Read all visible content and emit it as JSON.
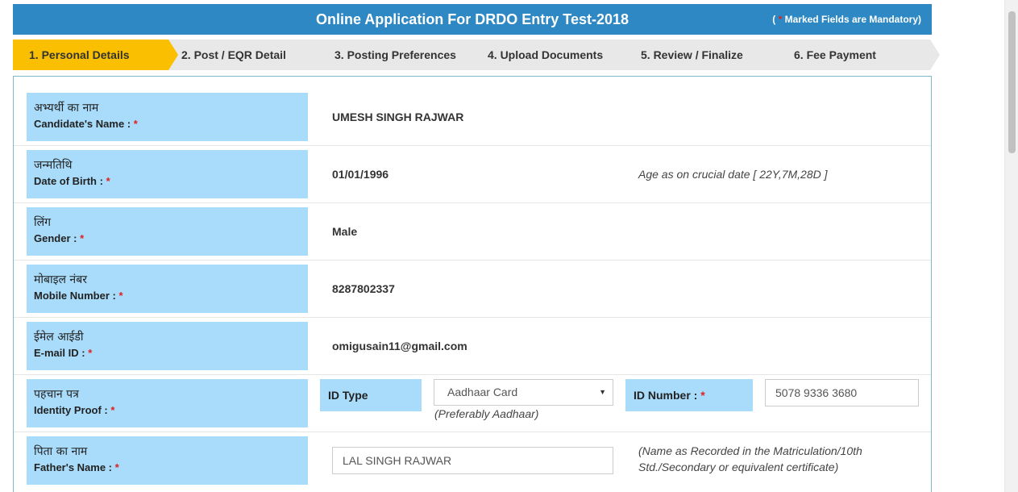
{
  "header": {
    "title": "Online Application For DRDO Entry Test-2018",
    "mandatory_open": "(",
    "mandatory_star": "*",
    "mandatory_text": " Marked Fields are Mandatory)"
  },
  "steps": [
    {
      "label": "1. Personal Details",
      "active": true
    },
    {
      "label": "2. Post / EQR Detail",
      "active": false
    },
    {
      "label": "3. Posting Preferences",
      "active": false
    },
    {
      "label": "4. Upload Documents",
      "active": false
    },
    {
      "label": "5. Review / Finalize",
      "active": false
    },
    {
      "label": "6. Fee Payment",
      "active": false
    }
  ],
  "form": {
    "required_mark": "*",
    "candidate_name": {
      "label_hi": "अभ्यर्थी का नाम",
      "label_en": "Candidate's Name :",
      "value": "UMESH SINGH RAJWAR"
    },
    "dob": {
      "label_hi": "जन्मतिथि",
      "label_en": "Date of Birth :",
      "value": "01/01/1996",
      "age_note": "Age as on crucial date [ 22Y,7M,28D ]"
    },
    "gender": {
      "label_hi": "लिंग",
      "label_en": "Gender :",
      "value": "Male"
    },
    "mobile": {
      "label_hi": "मोबाइल नंबर",
      "label_en": "Mobile Number :",
      "value": "8287802337"
    },
    "email": {
      "label_hi": "ईमेल आईडी",
      "label_en": "E-mail ID :",
      "value": "omigusain11@gmail.com"
    },
    "identity": {
      "label_hi": "पहचान पत्र",
      "label_en": "Identity Proof :",
      "id_type_label": "ID Type",
      "id_type_value": "Aadhaar Card",
      "id_type_hint": "(Preferably Aadhaar)",
      "id_number_label": "ID Number :",
      "id_number_value": "5078 9336 3680"
    },
    "father": {
      "label_hi": "पिता का नाम",
      "label_en": "Father's Name :",
      "value": "LAL SINGH RAJWAR",
      "note_line1": "(Name as Recorded in the Matriculation/10th",
      "note_line2": "Std./Secondary or equivalent certificate)"
    }
  },
  "colors": {
    "title_bar": "#2d88c4",
    "active_step": "#f9bf00",
    "inactive_step": "#e8e8e8",
    "label_box": "#a9dcfb",
    "required": "#e02020"
  }
}
